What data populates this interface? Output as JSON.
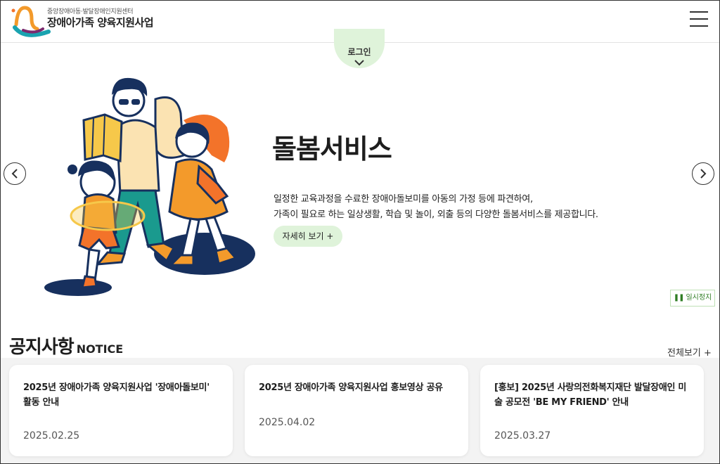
{
  "header": {
    "org_sub": "중앙장애아동·발달장애인지원센터",
    "org_main": "장애아가족 양육지원사업",
    "login_label": "로그인"
  },
  "hero": {
    "title": "돌봄서비스",
    "desc_line1": "일정한 교육과정을 수료한 장애아돌보미를 아동의 가정 등에 파견하여,",
    "desc_line2": "가족이 필요로 하는 일상생활, 학습 및 놀이, 외출 등의 다양한 돌봄서비스를 제공합니다.",
    "more_label": "자세히 보기 +",
    "pause_label": "일시정지"
  },
  "notice": {
    "title_ko": "공지사항",
    "title_en": "NOTICE",
    "view_all": "전체보기 +",
    "items": [
      {
        "title": "2025년 장애아가족 양육지원사업 '장애아돌보미' 활동 안내",
        "date": "2025.02.25"
      },
      {
        "title": "2025년 장애아가족 양육지원사업 홍보영상 공유",
        "date": "2025.04.02"
      },
      {
        "title": "[홍보] 2025년 사랑의전화복지재단 발달장애인 미술 공모전 'BE MY FRIEND' 안내",
        "date": "2025.03.27"
      }
    ]
  },
  "colors": {
    "accent_green": "#dff3da",
    "pause_green": "#2f7d23",
    "illustration_orange": "#f39a2b",
    "illustration_navy": "#17305e"
  },
  "icons": {
    "menu": "hamburger-icon",
    "login_chevron": "chevron-down-icon",
    "prev": "chevron-left-icon",
    "next": "chevron-right-icon",
    "pause": "pause-icon"
  }
}
